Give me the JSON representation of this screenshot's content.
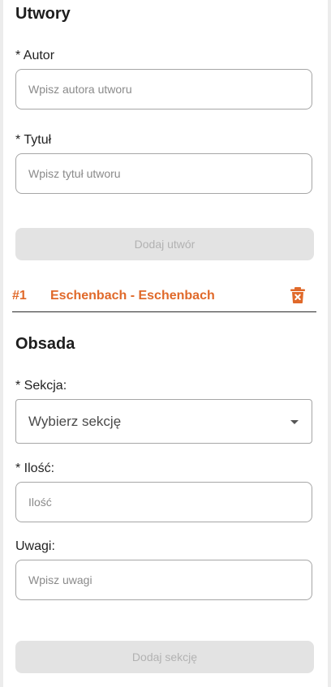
{
  "pieces": {
    "title": "Utwory",
    "author_label": "* Autor",
    "author_placeholder": "Wpisz autora utworu",
    "title_label": "* Tytuł",
    "title_placeholder": "Wpisz tytuł utworu",
    "add_button": "Dodaj utwór",
    "items": [
      {
        "number": "#1",
        "name": "Eschenbach - Eschenbach",
        "delete_icon": "trash-icon"
      }
    ]
  },
  "cast": {
    "title": "Obsada",
    "section_label": "* Sekcja:",
    "section_value": "Wybierz sekcję",
    "quantity_label": "* Ilość:",
    "quantity_placeholder": "Ilość",
    "notes_label": "Uwagi:",
    "notes_placeholder": "Wpisz uwagi",
    "add_button": "Dodaj sekcję"
  },
  "colors": {
    "accent": "#e0692a",
    "disabled_bg": "#e3e3e3",
    "disabled_text": "#b2b2b2"
  }
}
